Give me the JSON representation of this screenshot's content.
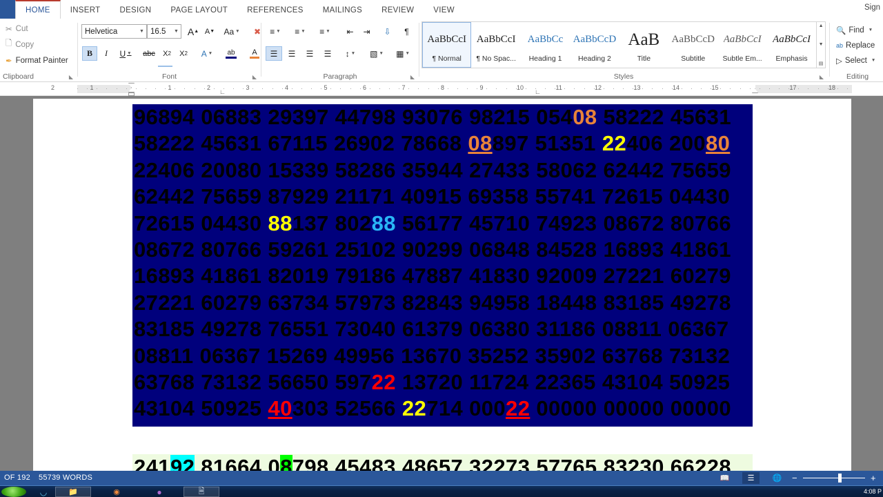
{
  "window": {
    "signin_label": "Sign"
  },
  "ribbon": {
    "tabs": [
      {
        "label": "HOME",
        "active": true
      },
      {
        "label": "INSERT",
        "active": false
      },
      {
        "label": "DESIGN",
        "active": false
      },
      {
        "label": "PAGE LAYOUT",
        "active": false
      },
      {
        "label": "REFERENCES",
        "active": false
      },
      {
        "label": "MAILINGS",
        "active": false
      },
      {
        "label": "REVIEW",
        "active": false
      },
      {
        "label": "VIEW",
        "active": false
      }
    ],
    "clipboard": {
      "group_label": "Clipboard",
      "cut_label": "Cut",
      "copy_label": "Copy",
      "format_painter_label": "Format Painter"
    },
    "font": {
      "group_label": "Font",
      "font_family_value": "Helvetica",
      "font_size_value": "16.5",
      "grow_font": "A",
      "shrink_font": "A",
      "change_case": "Aa",
      "clear_formatting": "A",
      "bold": "B",
      "italic": "I",
      "underline": "U",
      "strikethrough": "abc",
      "subscript": "X",
      "superscript": "X",
      "text_effects": "A",
      "highlight": "ab",
      "font_color": "A"
    },
    "paragraph": {
      "group_label": "Paragraph"
    },
    "styles": {
      "group_label": "Styles",
      "items": [
        {
          "preview": "AaBbCcI",
          "name": "¶ Normal",
          "selected": true
        },
        {
          "preview": "AaBbCcI",
          "name": "¶ No Spac...",
          "selected": false
        },
        {
          "preview": "AaBbCc",
          "name": "Heading 1",
          "selected": false
        },
        {
          "preview": "AaBbCcD",
          "name": "Heading 2",
          "selected": false
        },
        {
          "preview": "AaB",
          "name": "Title",
          "selected": false
        },
        {
          "preview": "AaBbCcD",
          "name": "Subtitle",
          "selected": false
        },
        {
          "preview": "AaBbCcI",
          "name": "Subtle Em...",
          "selected": false
        },
        {
          "preview": "AaBbCcI",
          "name": "Emphasis",
          "selected": false
        }
      ]
    },
    "editing": {
      "group_label": "Editing",
      "find_label": "Find",
      "replace_label": "Replace",
      "select_label": "Select"
    }
  },
  "ruler": {
    "left_labels": [
      "2",
      "1"
    ],
    "right_labels": [
      "1",
      "2",
      "3",
      "4",
      "5",
      "6",
      "7",
      "8",
      "9",
      "10",
      "11",
      "12",
      "13",
      "14",
      "15",
      "17",
      "18"
    ]
  },
  "document": {
    "selected_lines": [
      [
        {
          "t": "96894 06883 29397 44798 93076 98215 054",
          "s": "plain"
        },
        {
          "t": "08",
          "s": "orange"
        },
        {
          "t": " 58222 45631",
          "s": "plain"
        }
      ],
      [
        {
          "t": "58222 45631 67115 26902 78668 ",
          "s": "plain"
        },
        {
          "t": "08",
          "s": "orange-u"
        },
        {
          "t": "897 51351 ",
          "s": "plain"
        },
        {
          "t": "22",
          "s": "yellow"
        },
        {
          "t": "406 200",
          "s": "plain"
        },
        {
          "t": "80",
          "s": "orange-u"
        }
      ],
      [
        {
          "t": "22406 20080 15339 58286 35944 27433 58062 62442 75659",
          "s": "plain"
        }
      ],
      [
        {
          "t": "62442 75659 87929 21171 40915 69358 55741 72615 04430",
          "s": "plain"
        }
      ],
      [
        {
          "t": "72615 04430 ",
          "s": "plain"
        },
        {
          "t": "88",
          "s": "yellow"
        },
        {
          "t": "137 802",
          "s": "plain"
        },
        {
          "t": "88",
          "s": "cyan"
        },
        {
          "t": " 56177 45710 74923 08672 80766",
          "s": "plain"
        }
      ],
      [
        {
          "t": "08672 80766 59261 25102 90299 06848 84528 16893 41861",
          "s": "plain"
        }
      ],
      [
        {
          "t": "16893 41861 82019 79186 47887 41830 92009 27221 60279",
          "s": "plain"
        }
      ],
      [
        {
          "t": "27221 60279 63734 57973 82843 94958 18448 83185 49278",
          "s": "plain"
        }
      ],
      [
        {
          "t": "83185 49278 76551 73040 61379 06380 31186 08811 06367",
          "s": "plain"
        }
      ],
      [
        {
          "t": "08811 06367 15269 49956 13670 35252 35902 63768 73132",
          "s": "plain"
        }
      ],
      [
        {
          "t": "63768 73132 56650 597",
          "s": "plain"
        },
        {
          "t": "22",
          "s": "red"
        },
        {
          "t": " 13720 11724 22365 43104 50925",
          "s": "plain"
        }
      ],
      [
        {
          "t": "43104 50925 ",
          "s": "plain"
        },
        {
          "t": "40",
          "s": "red-u"
        },
        {
          "t": "303 52566 ",
          "s": "plain"
        },
        {
          "t": "22",
          "s": "yellow"
        },
        {
          "t": "714 000",
          "s": "plain"
        },
        {
          "t": "22",
          "s": "red-u"
        },
        {
          "t": " 00000 00000 00000",
          "s": "plain"
        }
      ]
    ],
    "tail_line": [
      {
        "t": "241",
        "s": "plain"
      },
      {
        "t": "92",
        "s": "hl-cyan"
      },
      {
        "t": " 81664 0",
        "s": "plain"
      },
      {
        "t": "8",
        "s": "hl-green"
      },
      {
        "t": "798 45483 48657 32273 57765 83230 66228",
        "s": "plain"
      }
    ]
  },
  "statusbar": {
    "page_label": "OF 192",
    "words_label": "55739 WORDS",
    "zoom_minus": "−",
    "zoom_plus": "+"
  },
  "taskbar": {
    "clock": "4:08 P"
  },
  "colors": {
    "accent": "#2b579a",
    "selection_bg": "#00007c",
    "orange": "#e8833a",
    "yellow": "#ffff00",
    "cyan": "#29b6f6",
    "red": "#ff0000",
    "tail_bg": "#eefbe0"
  }
}
